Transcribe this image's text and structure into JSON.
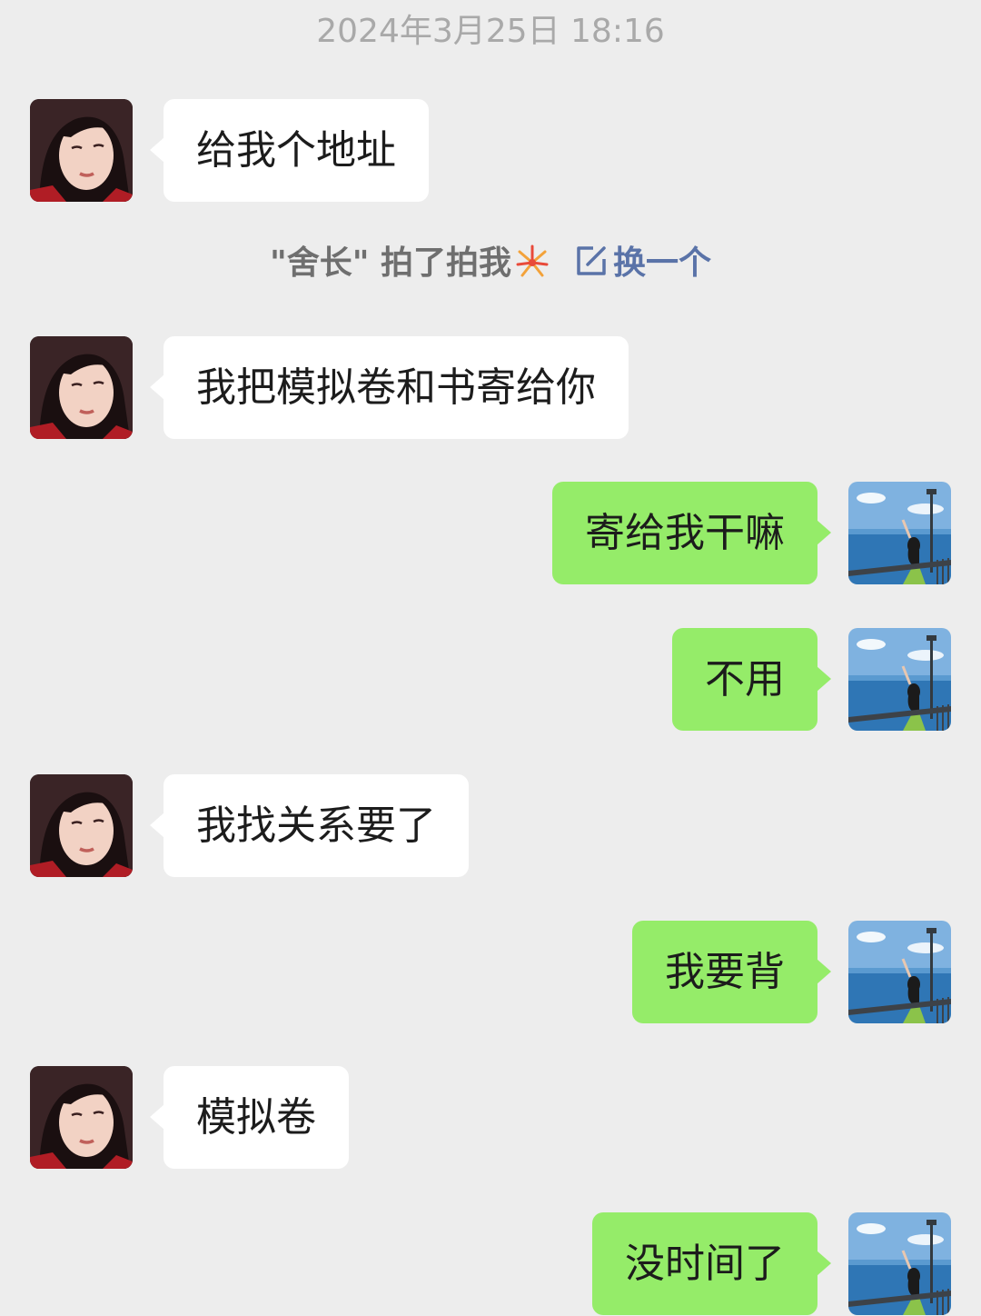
{
  "timestamp": "2024年3月25日 18:16",
  "system_notice": {
    "pat_text": "\"舍长\" 拍了拍我",
    "pat_icon": "fireworks-icon",
    "change_label": "换一个",
    "change_icon": "edit-icon"
  },
  "colors": {
    "background": "#ededed",
    "incoming_bubble": "#ffffff",
    "outgoing_bubble": "#95ec69",
    "link": "#5a73a8"
  },
  "messages": [
    {
      "sender": "other",
      "text": "给我个地址"
    },
    {
      "sender": "other",
      "text": "我把模拟卷和书寄给你"
    },
    {
      "sender": "me",
      "text": "寄给我干嘛"
    },
    {
      "sender": "me",
      "text": "不用"
    },
    {
      "sender": "other",
      "text": "我找关系要了"
    },
    {
      "sender": "me",
      "text": "我要背"
    },
    {
      "sender": "other",
      "text": "模拟卷"
    },
    {
      "sender": "me",
      "text": "没时间了"
    }
  ]
}
